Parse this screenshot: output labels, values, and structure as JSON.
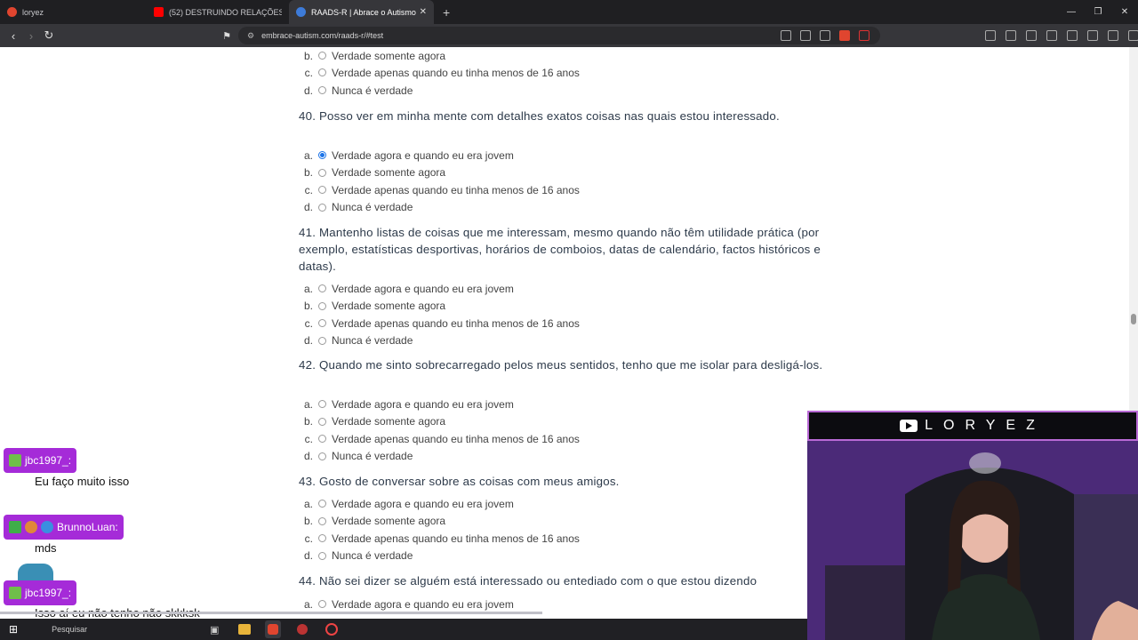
{
  "browser": {
    "tabs": [
      {
        "label": "loryez",
        "icon_color": "#e0452f"
      },
      {
        "label": "(52) DESTRUINDO RELAÇÕES EM EVI",
        "icon_color": "#ff0000"
      },
      {
        "label": "RAADS-R | Abrace o Autismo",
        "icon_color": "#3d7bd9"
      }
    ],
    "url": "embrace-autism.com/raads-r/#test"
  },
  "options": [
    "Verdade agora e quando eu era jovem",
    "Verdade somente agora",
    "Verdade apenas quando eu tinha menos de 16 anos",
    "Nunca é verdade"
  ],
  "letters": [
    "a.",
    "b.",
    "c.",
    "d."
  ],
  "partial_prev": {
    "b": "Verdade somente agora",
    "c": "Verdade apenas quando eu tinha menos de 16 anos",
    "d": "Nunca é verdade"
  },
  "questions": [
    {
      "title": "40. Posso ver em minha mente com detalhes exatos coisas nas quais estou interessado.",
      "selected": 0
    },
    {
      "title": "41. Mantenho listas de coisas que me interessam, mesmo quando não têm utilidade prática (por exemplo, estatísticas desportivas, horários de comboios, datas de calendário, factos históricos e datas).",
      "selected": -1
    },
    {
      "title": "42. Quando me sinto sobrecarregado pelos meus sentidos, tenho que me isolar para desligá-los.",
      "selected": -1
    },
    {
      "title": "43. Gosto de conversar sobre as coisas com meus amigos.",
      "selected": -1
    },
    {
      "title": "44. Não sei dizer se alguém está interessado ou entediado com o que estou dizendo",
      "selected": -1
    }
  ],
  "chat": [
    {
      "user": "jbc1997_:",
      "message": "Eu faço muito isso"
    },
    {
      "user": "BrunnoLuan:",
      "message": "mds"
    },
    {
      "user": "jbc1997_:",
      "message": "Isso aí eu não tenho não skkksk"
    }
  ],
  "stream": {
    "title": "LORYEZ"
  },
  "taskbar": {
    "search_placeholder": "Pesquisar"
  }
}
